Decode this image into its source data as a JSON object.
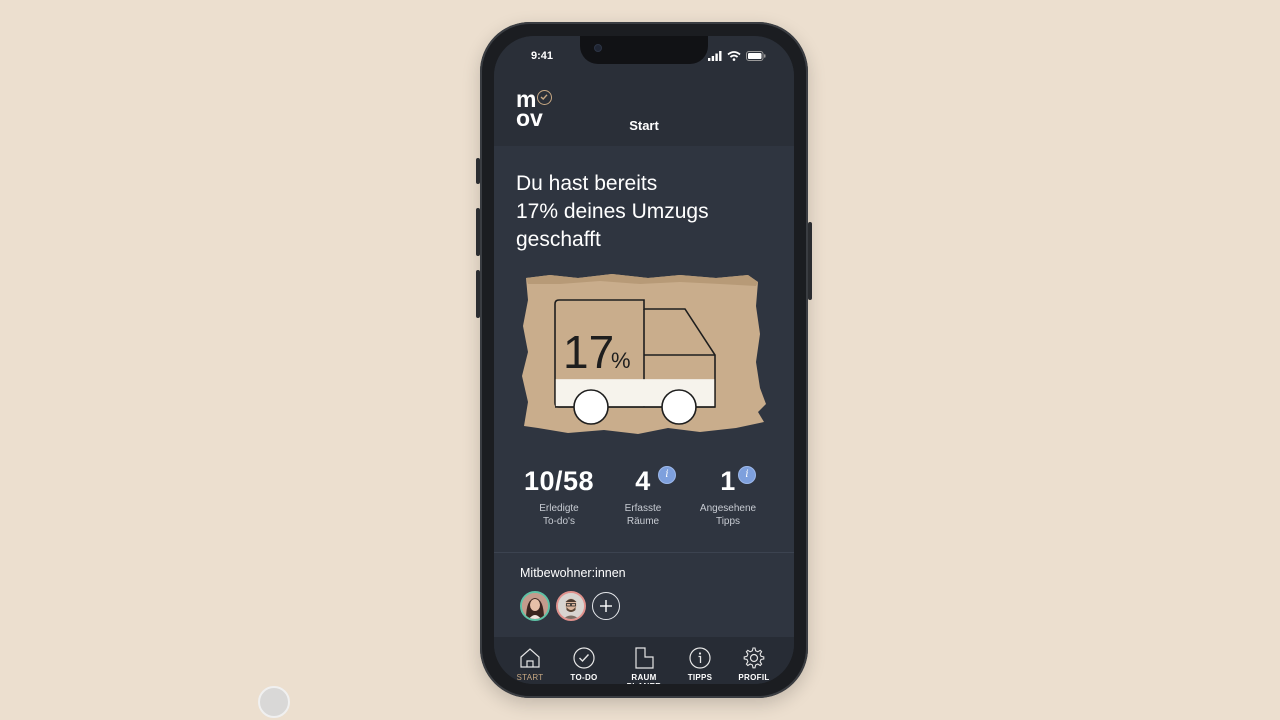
{
  "status": {
    "time": "9:41"
  },
  "header": {
    "logo_top": "m",
    "logo_bottom": "ov",
    "title": "Start"
  },
  "headline": {
    "line1": "Du hast bereits",
    "line2": "17% deines Umzugs",
    "line3": "geschafft"
  },
  "progress": {
    "value": "17",
    "unit": "%",
    "fraction": 0.17
  },
  "stats": [
    {
      "value": "10/58",
      "label": "Erledigte\nTo-do's",
      "info": false
    },
    {
      "value": "4",
      "label": "Erfasste\nRäume",
      "info": true
    },
    {
      "value": "1",
      "label": "Angesehene\nTipps",
      "info": true
    }
  ],
  "roommates": {
    "title": "Mitbewohner:innen"
  },
  "tabs": [
    {
      "label": "START",
      "icon": "home-icon",
      "active": true
    },
    {
      "label": "TO-DO",
      "icon": "check-circle-icon",
      "active": false
    },
    {
      "label": "RAUM\nPLANER",
      "icon": "floorplan-icon",
      "active": false
    },
    {
      "label": "TIPPS",
      "icon": "info-icon",
      "active": false
    },
    {
      "label": "PROFIL",
      "icon": "gear-icon",
      "active": false
    }
  ],
  "colors": {
    "background": "#ecdfcf",
    "screen": "#2f3540",
    "accent": "#c7a883",
    "info_badge": "#7ea0dd",
    "cardboard": "#c9ad8c"
  }
}
